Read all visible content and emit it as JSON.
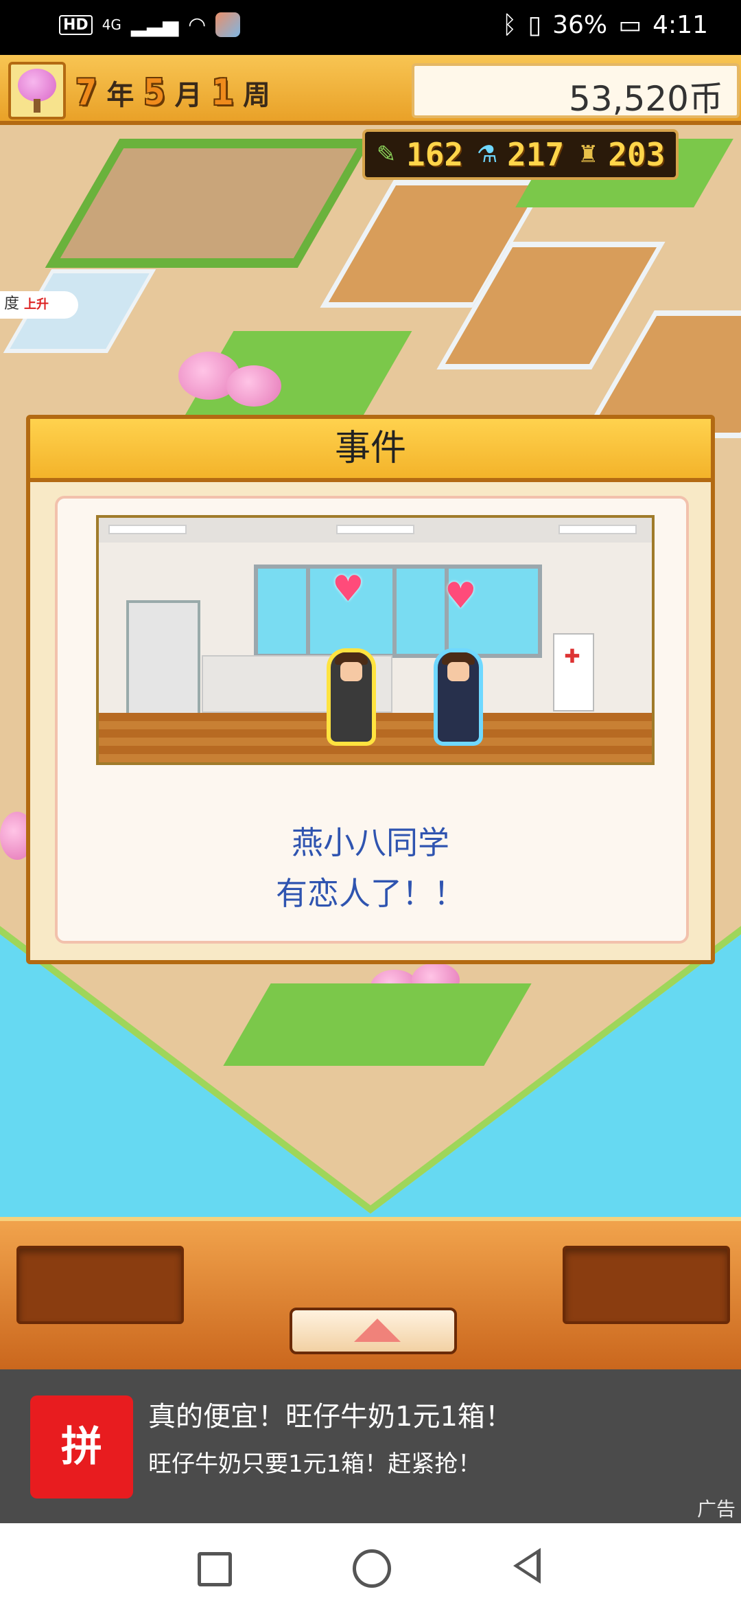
{
  "status_bar": {
    "hd": "HD",
    "network": "4G",
    "battery": "36%",
    "time": "4:11"
  },
  "hud": {
    "year_num": "7",
    "year_unit": "年",
    "month_num": "5",
    "month_unit": "月",
    "week_num": "1",
    "week_unit": "周",
    "money": "53,520币"
  },
  "stats": {
    "pencil": "162",
    "flask": "217",
    "trophy": "203"
  },
  "map": {
    "partial_label": "度",
    "up_label": "上升"
  },
  "event": {
    "title": "事件",
    "line1": "燕小八同学",
    "line2": "有恋人了！！"
  },
  "ad": {
    "title": "真的便宜！旺仔牛奶1元1箱！",
    "subtitle": "旺仔牛奶只要1元1箱！赶紧抢！",
    "tag": "广告",
    "icon_glyph": "拼"
  },
  "colors": {
    "hud_orange": "#f3b32a",
    "event_text": "#2f54b0",
    "sea": "#66d9f2"
  }
}
